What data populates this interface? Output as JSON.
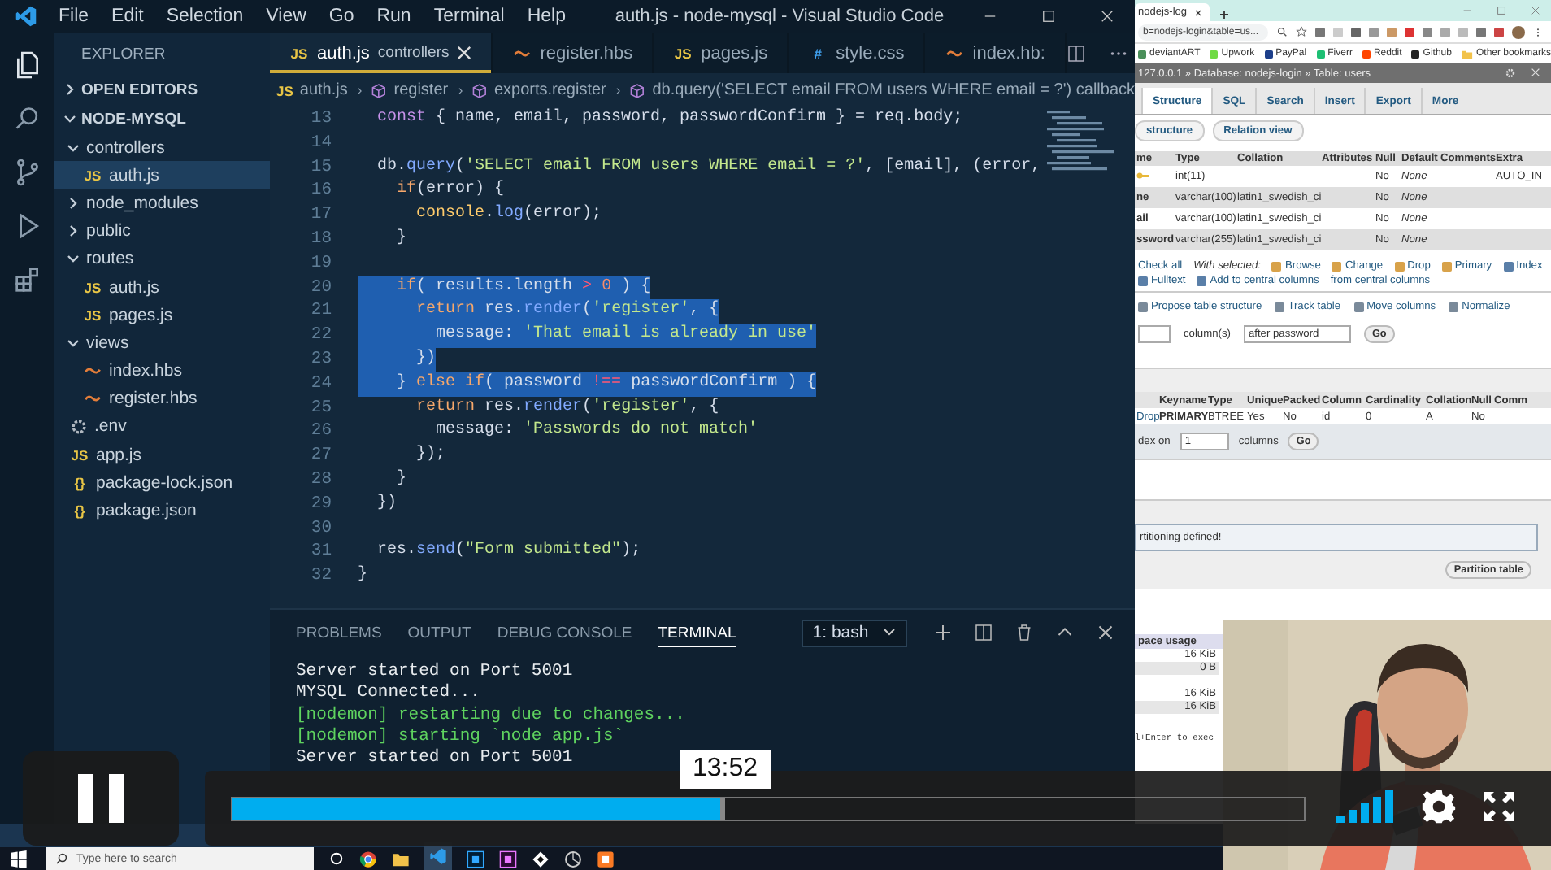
{
  "vscode": {
    "menu": [
      "File",
      "Edit",
      "Selection",
      "View",
      "Go",
      "Run",
      "Terminal",
      "Help"
    ],
    "title": "auth.js - node-mysql - Visual Studio Code",
    "explorer": {
      "title": "EXPLORER",
      "sections": [
        {
          "label": "OPEN EDITORS",
          "expanded": false
        },
        {
          "label": "NODE-MYSQL",
          "expanded": true
        }
      ],
      "tree": [
        {
          "label": "controllers",
          "kind": "folder",
          "expanded": true,
          "selected": false,
          "children": [
            {
              "label": "auth.js",
              "kind": "js",
              "badge": "JS",
              "selected": true
            }
          ]
        },
        {
          "label": "node_modules",
          "kind": "folder",
          "expanded": false,
          "selected": false
        },
        {
          "label": "public",
          "kind": "folder",
          "expanded": false,
          "selected": false
        },
        {
          "label": "routes",
          "kind": "folder",
          "expanded": true,
          "selected": false,
          "children": [
            {
              "label": "auth.js",
              "kind": "js",
              "badge": "JS",
              "selected": false
            },
            {
              "label": "pages.js",
              "kind": "js",
              "badge": "JS",
              "selected": false
            }
          ]
        },
        {
          "label": "views",
          "kind": "folder",
          "expanded": true,
          "selected": false,
          "children": [
            {
              "label": "index.hbs",
              "kind": "hbs",
              "selected": false
            },
            {
              "label": "register.hbs",
              "kind": "hbs",
              "selected": false
            }
          ]
        },
        {
          "label": ".env",
          "kind": "env",
          "selected": false
        },
        {
          "label": "app.js",
          "kind": "js",
          "badge": "JS",
          "selected": false
        },
        {
          "label": "package-lock.json",
          "kind": "json",
          "badge": "{}",
          "selected": false
        },
        {
          "label": "package.json",
          "kind": "json",
          "badge": "{}",
          "selected": false
        }
      ]
    },
    "tabs": [
      {
        "label": "auth.js",
        "detail": "controllers",
        "kind": "js",
        "badge": "JS",
        "selected": true
      },
      {
        "label": "register.hbs",
        "kind": "hbs",
        "selected": false
      },
      {
        "label": "pages.js",
        "kind": "js",
        "badge": "JS",
        "selected": false
      },
      {
        "label": "style.css",
        "kind": "css",
        "badge": "#",
        "selected": false
      },
      {
        "label": "index.hb:",
        "kind": "hbs",
        "selected": false
      }
    ],
    "breadcrumb": [
      {
        "label": "auth.js",
        "kind": "file",
        "badge": "JS"
      },
      {
        "label": "register",
        "kind": "symbol"
      },
      {
        "label": "exports.register",
        "kind": "symbol"
      },
      {
        "label": "db.query('SELECT email FROM users WHERE email = ?') callback",
        "kind": "symbol"
      }
    ],
    "lines": [
      {
        "number": "13",
        "selected": false,
        "tokens": [
          {
            "text": "  const",
            "kind": "decl"
          },
          {
            "text": " { name, email, password, passwordConfirm } = req.body;",
            "kind": "plain"
          }
        ]
      },
      {
        "number": "14",
        "selected": false
      },
      {
        "number": "15",
        "selected": false,
        "tokens": [
          {
            "text": "  db.",
            "kind": "plain"
          },
          {
            "text": "query",
            "kind": "function"
          },
          {
            "text": "(",
            "kind": "plain"
          },
          {
            "text": "'SELECT email FROM users WHERE email = ?'",
            "kind": "string"
          },
          {
            "text": ", [email], (error,",
            "kind": "plain"
          }
        ]
      },
      {
        "number": "16",
        "selected": false,
        "tokens": [
          {
            "text": "    if",
            "kind": "keyword"
          },
          {
            "text": "(error) {",
            "kind": "plain"
          }
        ]
      },
      {
        "number": "17",
        "selected": false,
        "tokens": [
          {
            "text": "      console",
            "kind": "object"
          },
          {
            "text": ".",
            "kind": "plain"
          },
          {
            "text": "log",
            "kind": "function"
          },
          {
            "text": "(error);",
            "kind": "plain"
          }
        ]
      },
      {
        "number": "18",
        "selected": false,
        "tokens": [
          {
            "text": "    }",
            "kind": "plain"
          }
        ]
      },
      {
        "number": "19",
        "selected": false
      },
      {
        "number": "20",
        "selected": true,
        "tokens": [
          {
            "text": "    if",
            "kind": "keyword"
          },
          {
            "text": "( results.length ",
            "kind": "plain"
          },
          {
            "text": ">",
            "kind": "operator"
          },
          {
            "text": " 0",
            "kind": "number"
          },
          {
            "text": " ) {",
            "kind": "plain"
          }
        ]
      },
      {
        "number": "21",
        "selected": true,
        "tokens": [
          {
            "text": "      return",
            "kind": "keyword"
          },
          {
            "text": " res.",
            "kind": "plain"
          },
          {
            "text": "render",
            "kind": "function"
          },
          {
            "text": "(",
            "kind": "plain"
          },
          {
            "text": "'register'",
            "kind": "string"
          },
          {
            "text": ", {",
            "kind": "plain"
          }
        ]
      },
      {
        "number": "22",
        "selected": true,
        "tokens": [
          {
            "text": "        message: ",
            "kind": "plain"
          },
          {
            "text": "'That email is already in use'",
            "kind": "string"
          }
        ]
      },
      {
        "number": "23",
        "selected": true,
        "tokens": [
          {
            "text": "      })",
            "kind": "plain"
          }
        ]
      },
      {
        "number": "24",
        "selected": true,
        "tokens": [
          {
            "text": "    } ",
            "kind": "plain"
          },
          {
            "text": "else if",
            "kind": "keyword"
          },
          {
            "text": "( password ",
            "kind": "plain"
          },
          {
            "text": "!==",
            "kind": "operator"
          },
          {
            "text": " passwordConfirm ) {",
            "kind": "plain"
          }
        ]
      },
      {
        "number": "25",
        "selected": false,
        "tokens": [
          {
            "text": "      return",
            "kind": "keyword"
          },
          {
            "text": " res.",
            "kind": "plain"
          },
          {
            "text": "render",
            "kind": "function"
          },
          {
            "text": "(",
            "kind": "plain"
          },
          {
            "text": "'register'",
            "kind": "string"
          },
          {
            "text": ", {",
            "kind": "plain"
          }
        ]
      },
      {
        "number": "26",
        "selected": false,
        "tokens": [
          {
            "text": "        message: ",
            "kind": "plain"
          },
          {
            "text": "'Passwords do not match'",
            "kind": "string"
          }
        ]
      },
      {
        "number": "27",
        "selected": false,
        "tokens": [
          {
            "text": "      });",
            "kind": "plain"
          }
        ]
      },
      {
        "number": "28",
        "selected": false,
        "tokens": [
          {
            "text": "    }",
            "kind": "plain"
          }
        ]
      },
      {
        "number": "29",
        "selected": false,
        "tokens": [
          {
            "text": "  })",
            "kind": "plain"
          }
        ]
      },
      {
        "number": "30",
        "selected": false
      },
      {
        "number": "31",
        "selected": false,
        "tokens": [
          {
            "text": "  res.",
            "kind": "plain"
          },
          {
            "text": "send",
            "kind": "function"
          },
          {
            "text": "(",
            "kind": "plain"
          },
          {
            "text": "\"Form submitted\"",
            "kind": "string"
          },
          {
            "text": ");",
            "kind": "plain"
          }
        ]
      },
      {
        "number": "32",
        "selected": false,
        "tokens": [
          {
            "text": "}",
            "kind": "plain"
          }
        ]
      }
    ],
    "panel": {
      "tabs": [
        {
          "label": "PROBLEMS",
          "selected": false
        },
        {
          "label": "OUTPUT",
          "selected": false
        },
        {
          "label": "DEBUG CONSOLE",
          "selected": false
        },
        {
          "label": "TERMINAL",
          "selected": true
        }
      ],
      "terminal": "1: bash",
      "output": [
        {
          "text": "Server started on Port 5001",
          "kind": "app"
        },
        {
          "text": "MYSQL Connected...",
          "kind": "app"
        },
        {
          "text": "[nodemon] restarting due to changes...",
          "kind": "nodemon"
        },
        {
          "text": "[nodemon] starting `node app.js`",
          "kind": "nodemon"
        },
        {
          "text": "Server started on Port 5001",
          "kind": "app"
        }
      ]
    }
  },
  "browser": {
    "tab_title": "nodejs-log",
    "url": "b=nodejs-login&table=us...",
    "bookmarks": [
      {
        "label": "deviantART",
        "color": "#4a8f5a"
      },
      {
        "label": "Upwork",
        "color": "#6fda44"
      },
      {
        "label": "PayPal",
        "color": "#1d3f8a"
      },
      {
        "label": "Fiverr",
        "color": "#1dbf73"
      },
      {
        "label": "Reddit",
        "color": "#ff4500"
      },
      {
        "label": "Github",
        "color": "#222222"
      }
    ],
    "other_bookmarks": "Other bookmarks",
    "location": "127.0.0.1 » Database: nodejs-login » Table: users",
    "tabs": [
      {
        "label": "Structure",
        "selected": true
      },
      {
        "label": "SQL",
        "selected": false
      },
      {
        "label": "Search",
        "selected": false
      },
      {
        "label": "Insert",
        "selected": false
      },
      {
        "label": "Export",
        "selected": false
      },
      {
        "label": "More",
        "selected": false
      }
    ],
    "subtabs": [
      "structure",
      "Relation view"
    ],
    "columns": [
      "me",
      "Type",
      "Collation",
      "Attributes",
      "Null",
      "Default",
      "Comments",
      "Extra"
    ],
    "rows": [
      {
        "key": true,
        "type": "int(11)",
        "null": "No",
        "default": "None",
        "extra": "AUTO_IN"
      },
      {
        "key": false,
        "name": "ne",
        "type": "varchar(100)",
        "collation": "latin1_swedish_ci",
        "null": "No",
        "default": "None"
      },
      {
        "key": false,
        "name": "ail",
        "type": "varchar(100)",
        "collation": "latin1_swedish_ci",
        "null": "No",
        "default": "None"
      },
      {
        "key": false,
        "name": "ssword",
        "type": "varchar(255)",
        "collation": "latin1_swedish_ci",
        "null": "No",
        "default": "None"
      }
    ],
    "check_all": "Check all",
    "with_selected": "With selected:",
    "actions": [
      "Browse",
      "Change",
      "Drop",
      "Primary"
    ],
    "actions2": [
      "Index",
      "Fulltext",
      "Add to central columns"
    ],
    "remove_central": "from central columns",
    "tools": [
      "Propose table structure",
      "Track table",
      "Move columns",
      "Normalize"
    ],
    "add_columns": {
      "label": "column(s)",
      "position": "after password",
      "button": "Go"
    },
    "index_columns": [
      "Keyname",
      "Type",
      "Unique",
      "Packed",
      "Column",
      "Cardinality",
      "Collation",
      "Null",
      "Comm"
    ],
    "index_row": [
      "Drop",
      "PRIMARY",
      "BTREE",
      "Yes",
      "No",
      "id",
      "0",
      "A",
      "No"
    ],
    "create_index": {
      "label": "dex on",
      "value": "1",
      "unit": "columns",
      "button": "Go"
    },
    "partition_message": "rtitioning defined!",
    "partition_button": "Partition table",
    "space_usage": {
      "title": "pace usage",
      "values": [
        "16 KiB",
        "0 B",
        "16 KiB",
        "16 KiB"
      ]
    },
    "console_hint": "l+Enter to exec"
  },
  "player": {
    "playing": true,
    "progress": {
      "level": 0.46
    },
    "time": "13:52"
  },
  "taskbar": {
    "search": {
      "placeholder": "Type here to search"
    }
  }
}
